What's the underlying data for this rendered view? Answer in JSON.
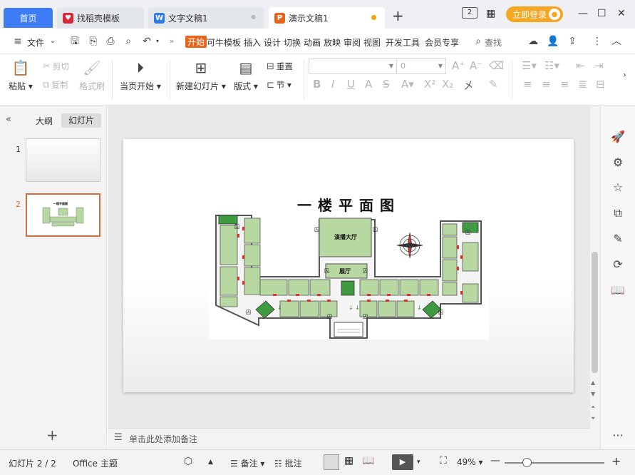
{
  "tabs": {
    "home": "首页",
    "templates": "找稻壳模板",
    "doc": "文字文稿1",
    "ppt": "演示文稿1",
    "doc_close": "●"
  },
  "window": {
    "badge": "2",
    "login": "立即登录"
  },
  "menu": {
    "file": "文件",
    "start": "开始",
    "items": [
      "可牛模板",
      "插入",
      "设计",
      "切换",
      "动画",
      "放映",
      "审阅",
      "视图",
      "开发工具",
      "会员专享"
    ],
    "search": "查找"
  },
  "ribbon": {
    "paste": "粘贴",
    "cut": "剪切",
    "copy": "复制",
    "format_painter": "格式刷",
    "play_from_start": "当页开始",
    "new_slide": "新建幻灯片",
    "layout": "版式",
    "section": "节",
    "reset": "重置",
    "font_name": "",
    "font_size": "0"
  },
  "left_panel": {
    "outline": "大纲",
    "slides": "幻灯片",
    "thumbs": [
      "1",
      "2"
    ],
    "thumb2_caption": "一楼平面图"
  },
  "slide": {
    "title": "一楼平面图",
    "hall": "演播大厅",
    "exhibition": "展厅"
  },
  "notes": {
    "placeholder": "单击此处添加备注"
  },
  "status": {
    "slide_counter": "幻灯片 2 / 2",
    "theme": "Office 主题",
    "notes": "备注",
    "comments": "批注",
    "zoom": "49%"
  },
  "colors": {
    "accent_blue": "#3d7cf4",
    "accent_orange": "#e8651b",
    "login_orange": "#f5a623",
    "room_green": "#b7d8a0"
  }
}
